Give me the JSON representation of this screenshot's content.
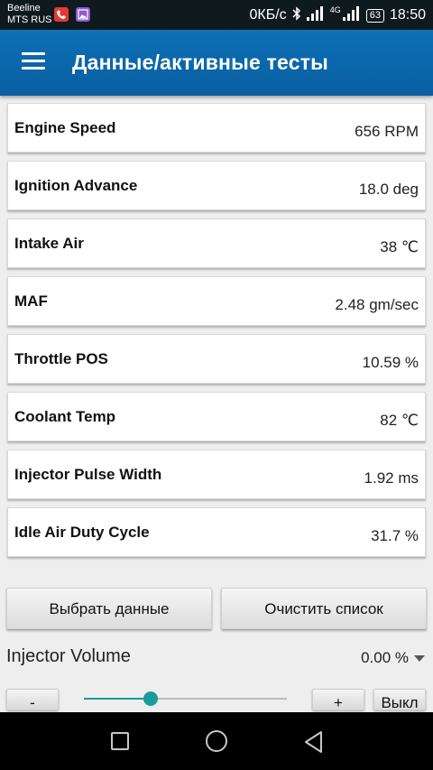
{
  "status_bar": {
    "carrier_1": "Beeline",
    "carrier_2": "MTS RUS",
    "net_speed": "0КБ/с",
    "network_type": "4G",
    "battery": "63",
    "time": "18:50"
  },
  "app_bar": {
    "title": "Данные/активные тесты"
  },
  "data_items": [
    {
      "label": "Engine Speed",
      "value": "656 RPM"
    },
    {
      "label": "Ignition Advance",
      "value": "18.0 deg"
    },
    {
      "label": "Intake Air",
      "value": "38 ℃"
    },
    {
      "label": "MAF",
      "value": "2.48 gm/sec"
    },
    {
      "label": "Throttle POS",
      "value": "10.59 %"
    },
    {
      "label": "Coolant Temp",
      "value": "82 ℃"
    },
    {
      "label": "Injector Pulse Width",
      "value": "1.92 ms"
    },
    {
      "label": "Idle Air Duty Cycle",
      "value": "31.7 %"
    }
  ],
  "buttons": {
    "select_data": "Выбрать данные",
    "clear_list": "Очистить список"
  },
  "injector": {
    "label": "Injector Volume",
    "value": "0.00 %"
  },
  "controls": {
    "minus": "-",
    "plus": "+",
    "off": "Выкл",
    "slider_level": 0.33
  },
  "colors": {
    "app_bar": "#0d6fb6",
    "slider_accent": "#1a9a9a",
    "phone_notification": "#e53935",
    "gallery_notification": "#8e5ad1"
  }
}
